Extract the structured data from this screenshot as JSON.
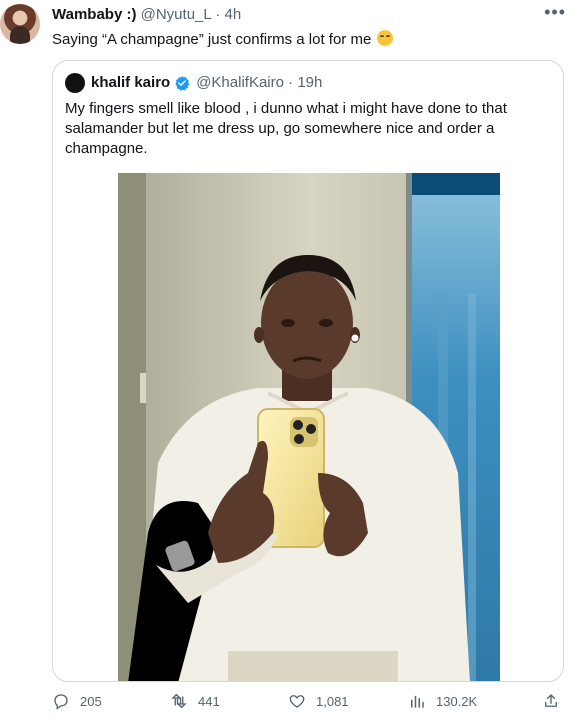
{
  "tweet": {
    "display_name": "Wambaby :)",
    "handle": "@Nyutu_L",
    "time": "4h",
    "text": "Saying “A champagne” just confirms a lot for me",
    "more_icon": "more-horizontal-icon"
  },
  "quoted": {
    "display_name": "khalif kairo",
    "handle": "@KhalifKairo",
    "time": "19h",
    "text": "My fingers smell like blood , i dunno what i might have done to that salamander but let me dress up, go somewhere nice and order a champagne.",
    "verified_color": "#1d9bf0"
  },
  "actions": {
    "replies": "205",
    "retweets": "441",
    "likes": "1,081",
    "views": "130.2K"
  },
  "colors": {
    "text": "#0f1419",
    "secondary": "#536471",
    "border": "#cfd9de",
    "brand": "#1d9bf0"
  }
}
